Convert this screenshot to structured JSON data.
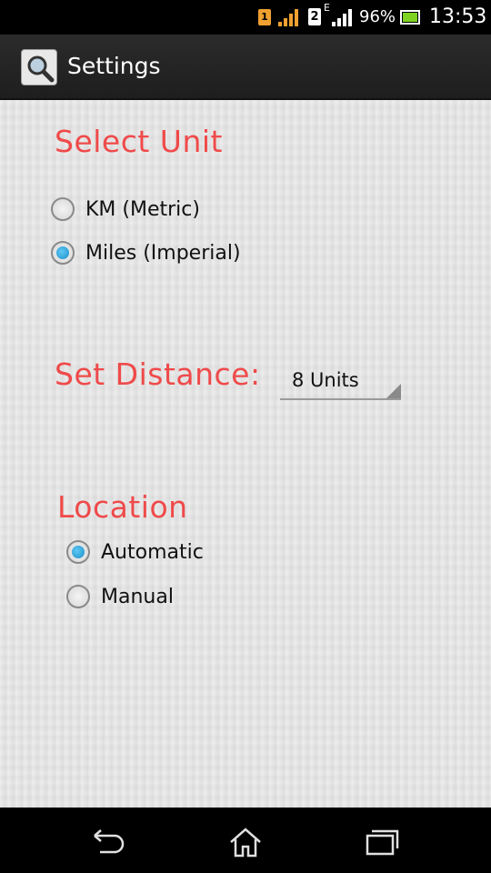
{
  "status_bar": {
    "notification_badge": "1",
    "sim2_label": "2",
    "network_type": "E",
    "battery_percent": "96%",
    "clock": "13:53"
  },
  "action_bar": {
    "title": "Settings",
    "app_icon": "magnifier-icon"
  },
  "unit_section": {
    "title": "Select Unit",
    "options": [
      {
        "label": "KM (Metric)",
        "checked": false
      },
      {
        "label": "Miles (Imperial)",
        "checked": true
      }
    ]
  },
  "distance_section": {
    "title": "Set Distance:",
    "selected_value": "8 Units"
  },
  "location_section": {
    "title": "Location",
    "options": [
      {
        "label": "Automatic",
        "checked": true
      },
      {
        "label": "Manual",
        "checked": false
      }
    ]
  },
  "nav_bar": {
    "icons": [
      "back-icon",
      "home-icon",
      "recent-apps-icon"
    ]
  },
  "colors": {
    "section_title": "#ef4a4a",
    "radio_selected": "#1b8fc8",
    "action_bar_bg": "#2b2b2b"
  }
}
